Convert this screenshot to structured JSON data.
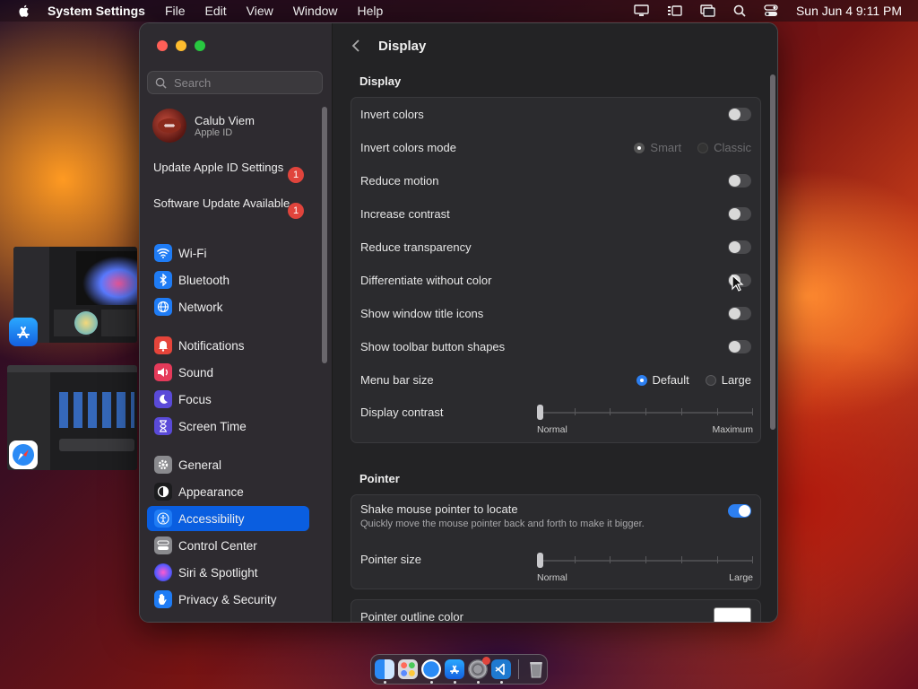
{
  "menubar": {
    "app_name": "System Settings",
    "items": [
      "File",
      "Edit",
      "View",
      "Window",
      "Help"
    ],
    "clock": "Sun Jun 4  9:11 PM"
  },
  "sidebar": {
    "search_placeholder": "Search",
    "profile": {
      "name": "Calub Viem",
      "subtitle": "Apple ID"
    },
    "notices": [
      {
        "label": "Update Apple ID Settings",
        "badge": "1"
      },
      {
        "label": "Software Update Available",
        "badge": "1"
      }
    ],
    "items": [
      {
        "label": "Wi-Fi",
        "icon": "wifi-icon",
        "color": "#1f7cf5"
      },
      {
        "label": "Bluetooth",
        "icon": "bluetooth-icon",
        "color": "#1f7cf5"
      },
      {
        "label": "Network",
        "icon": "globe-icon",
        "color": "#1f7cf5"
      },
      {
        "label": "Notifications",
        "icon": "bell-icon",
        "color": "#e5443a"
      },
      {
        "label": "Sound",
        "icon": "speaker-icon",
        "color": "#e53a5a"
      },
      {
        "label": "Focus",
        "icon": "moon-icon",
        "color": "#5a4ad8"
      },
      {
        "label": "Screen Time",
        "icon": "hourglass-icon",
        "color": "#5a4ad8"
      },
      {
        "label": "General",
        "icon": "gear-icon",
        "color": "#8a8a8e"
      },
      {
        "label": "Appearance",
        "icon": "appearance-icon",
        "color": "#1c1c1e"
      },
      {
        "label": "Accessibility",
        "icon": "accessibility-icon",
        "color": "#1f7cf5",
        "active": true
      },
      {
        "label": "Control Center",
        "icon": "control-center-icon",
        "color": "#8a8a8e"
      },
      {
        "label": "Siri & Spotlight",
        "icon": "siri-icon",
        "color": "#c03adf"
      },
      {
        "label": "Privacy & Security",
        "icon": "hand-icon",
        "color": "#1f7cf5"
      }
    ]
  },
  "content": {
    "title": "Display",
    "display_section": "Display",
    "rows": {
      "invert_colors": {
        "label": "Invert colors",
        "on": false
      },
      "invert_mode": {
        "label": "Invert colors mode",
        "options": [
          "Smart",
          "Classic"
        ],
        "selected": "Smart"
      },
      "reduce_motion": {
        "label": "Reduce motion",
        "on": false
      },
      "increase_contrast": {
        "label": "Increase contrast",
        "on": false
      },
      "reduce_transparency": {
        "label": "Reduce transparency",
        "on": false
      },
      "differentiate": {
        "label": "Differentiate without color",
        "on": false
      },
      "window_title_icons": {
        "label": "Show window title icons",
        "on": false
      },
      "toolbar_shapes": {
        "label": "Show toolbar button shapes",
        "on": false
      },
      "menu_bar_size": {
        "label": "Menu bar size",
        "options": [
          "Default",
          "Large"
        ],
        "selected": "Default"
      },
      "display_contrast": {
        "label": "Display contrast",
        "min_label": "Normal",
        "max_label": "Maximum",
        "value": 0
      }
    },
    "pointer_section": "Pointer",
    "pointer": {
      "shake": {
        "label": "Shake mouse pointer to locate",
        "desc": "Quickly move the mouse pointer back and forth to make it bigger.",
        "on": true
      },
      "size": {
        "label": "Pointer size",
        "min_label": "Normal",
        "max_label": "Large",
        "value": 0
      },
      "outline": {
        "label": "Pointer outline color",
        "color": "#ffffff"
      }
    }
  },
  "dock": [
    "finder-icon",
    "launchpad-icon",
    "safari-icon",
    "app-store-icon",
    "system-settings-icon",
    "vscode-icon",
    "trash-icon"
  ]
}
